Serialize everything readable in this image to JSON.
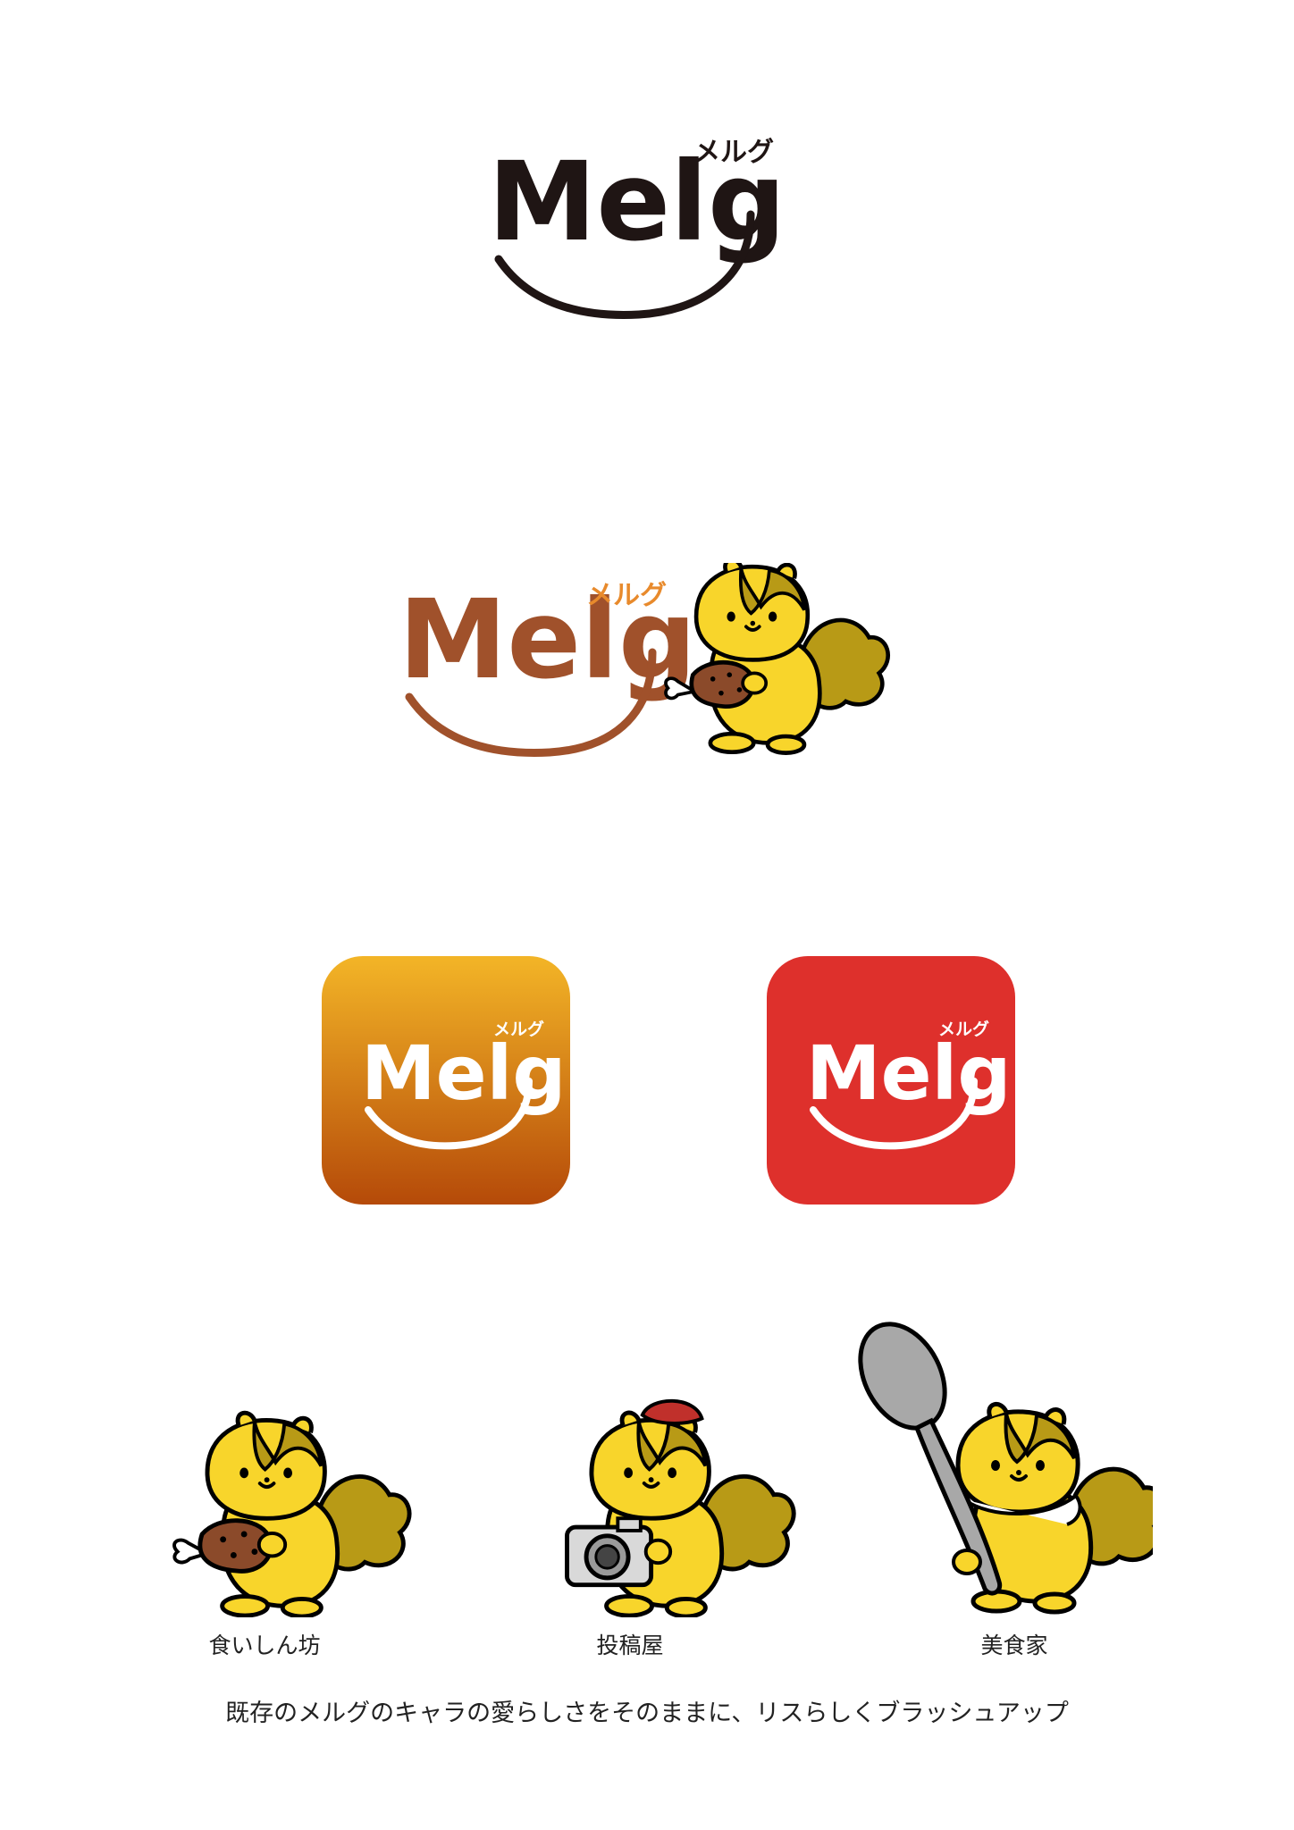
{
  "logo_black": {
    "wordmark": "Melg",
    "kana": "メルグ"
  },
  "logo_color": {
    "wordmark": "Melg",
    "kana": "メルグ"
  },
  "app_icons": [
    {
      "wordmark": "Melg",
      "kana": "メルグ",
      "colors": [
        "#f3b527",
        "#b54a09"
      ]
    },
    {
      "wordmark": "Melg",
      "kana": "メルグ",
      "colors": [
        "#de302c"
      ]
    }
  ],
  "characters": [
    {
      "name": "食いしん坊",
      "icon": "squirrel-with-meat-icon"
    },
    {
      "name": "投稿屋",
      "icon": "squirrel-with-camera-icon"
    },
    {
      "name": "美食家",
      "icon": "squirrel-with-spoon-icon"
    }
  ],
  "tagline": "既存のメルグのキャラの愛らしさをそのままに、リスらしくブラッシュアップ",
  "colors": {
    "brown_logo": "#a0512b",
    "kana_orange": "#e88a2c",
    "squirrel_yellow": "#f8d52b",
    "tail": "#b89a16"
  }
}
